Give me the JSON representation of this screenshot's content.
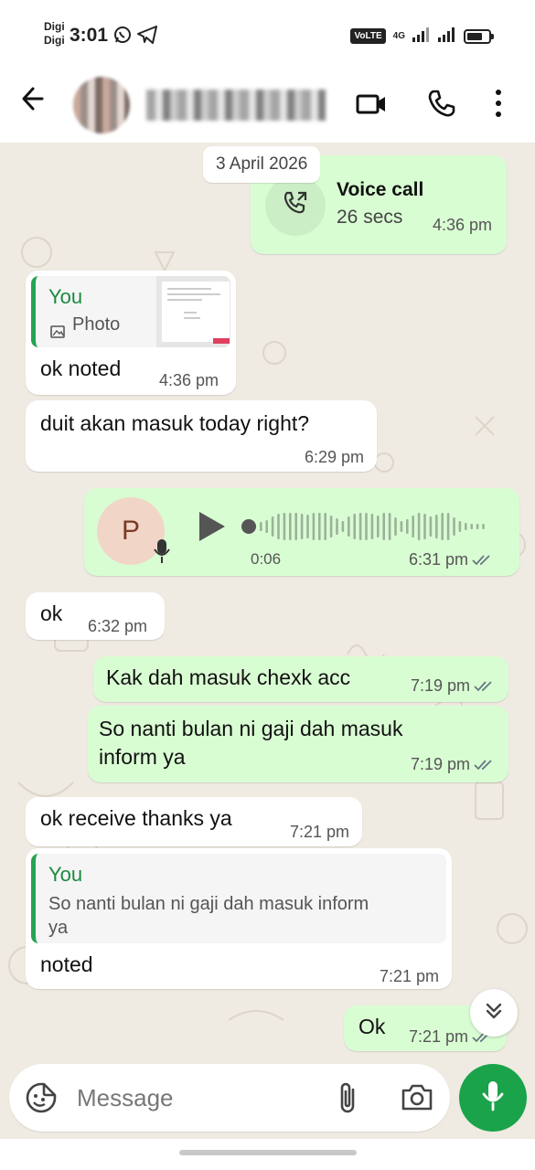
{
  "status_bar": {
    "carrier_1": "Digi",
    "carrier_2": "Digi",
    "time": "3:01",
    "volte": "VoLTE",
    "network": "4G"
  },
  "header": {
    "contact_name": "",
    "icons": [
      "back-arrow-icon",
      "video-call-icon",
      "phone-icon",
      "more-vert-icon"
    ]
  },
  "chat": {
    "date_chip": "3 April 2026",
    "voice_call": {
      "title": "Voice call",
      "duration": "26 secs",
      "time": "4:36 pm"
    },
    "msg_photo_reply": {
      "quote_name": "You",
      "quote_label": "Photo",
      "text": "ok noted",
      "time": "4:36 pm"
    },
    "msg_duit": {
      "text": "duit akan masuk today right?",
      "time": "6:29 pm"
    },
    "voice_note": {
      "avatar_letter": "P",
      "duration": "0:06",
      "time": "6:31 pm",
      "progress": 0
    },
    "msg_ok": {
      "text": "ok",
      "time": "6:32 pm"
    },
    "msg_kak": {
      "text": "Kak dah masuk chexk acc",
      "time": "7:19 pm"
    },
    "msg_nanti": {
      "line1": "So nanti bulan ni gaji dah masuk",
      "line2": "inform ya",
      "time": "7:19 pm"
    },
    "msg_receive": {
      "text": "ok receive thanks ya",
      "time": "7:21 pm"
    },
    "msg_noted": {
      "quote_name": "You",
      "quote_line1": "So nanti bulan ni gaji dah masuk inform",
      "quote_line2": "ya",
      "text": "noted",
      "time": "7:21 pm"
    },
    "msg_ok_out": {
      "text": "Ok",
      "time": "7:21 pm"
    }
  },
  "input": {
    "placeholder": "Message"
  },
  "colors": {
    "outgoing_bubble": "#d9fdd3",
    "incoming_bubble": "#ffffff",
    "chat_background": "#efeae2",
    "accent_green": "#1aa34a",
    "read_ticks": "#667781"
  }
}
